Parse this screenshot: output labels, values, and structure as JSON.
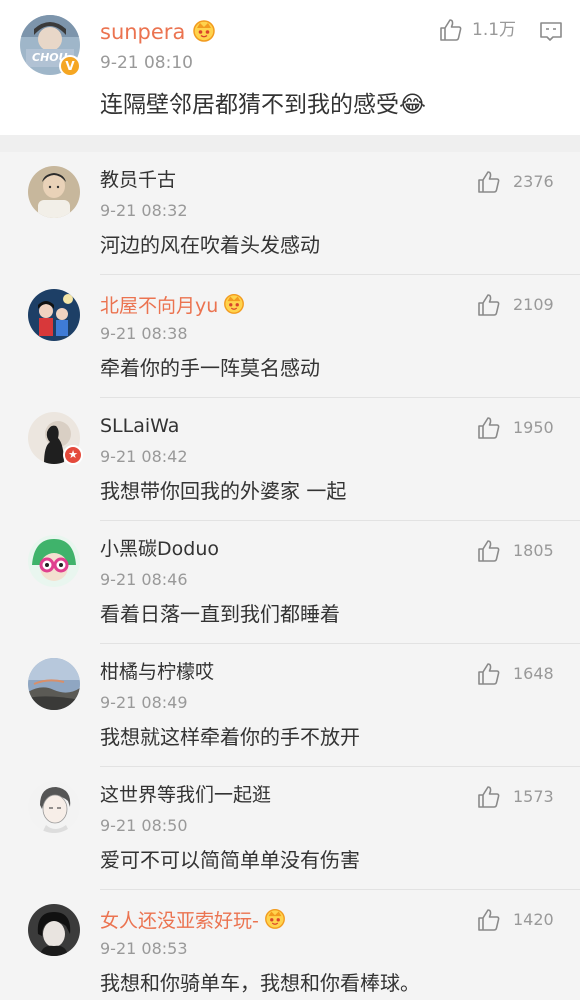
{
  "main_comment": {
    "username": "sunpera",
    "time": "9-21 08:10",
    "text": "连隔壁邻居都猜不到我的感受😂",
    "like_count": "1.1万",
    "avatar_text": "CHOU",
    "vip_color": "#eb7350"
  },
  "replies": [
    {
      "username": "教员千古",
      "time": "9-21 08:32",
      "text": "河边的风在吹着头发感动",
      "likes": "2376",
      "vip": false
    },
    {
      "username": "北屋不向月yu",
      "time": "9-21 08:38",
      "text": "牵着你的手一阵莫名感动",
      "likes": "2109",
      "vip": true
    },
    {
      "username": "SLLaiWa",
      "time": "9-21 08:42",
      "text": "我想带你回我的外婆家 一起",
      "likes": "1950",
      "vip": false
    },
    {
      "username": "小黑碳Doduo",
      "time": "9-21 08:46",
      "text": "看着日落一直到我们都睡着",
      "likes": "1805",
      "vip": false
    },
    {
      "username": "柑橘与柠檬哎",
      "time": "9-21 08:49",
      "text": "我想就这样牵着你的手不放开",
      "likes": "1648",
      "vip": false
    },
    {
      "username": "这世界等我们一起逛",
      "time": "9-21 08:50",
      "text": "爱可不可以简简单单没有伤害",
      "likes": "1573",
      "vip": false
    },
    {
      "username": "女人还没亚索好玩-",
      "time": "9-21 08:53",
      "text": "我想和你骑单车，我想和你看棒球。",
      "likes": "1420",
      "vip": true
    }
  ]
}
